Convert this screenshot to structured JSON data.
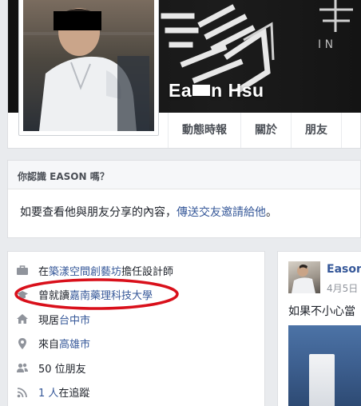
{
  "profile": {
    "name_prefix": "Ea",
    "name_suffix": "n Hsu"
  },
  "tabs": [
    "動態時報",
    "關於",
    "朋友"
  ],
  "know": {
    "title": "你認識 EASON 嗎？",
    "text": "如要查看他與朋友分享的內容，",
    "link": "傳送交友邀請給他",
    "end": "。"
  },
  "intro": {
    "work": {
      "pre": "在",
      "link": "築漾空間創藝坊",
      "post": "擔任設計師"
    },
    "study": {
      "pre": "曾就讀",
      "link": "嘉南藥理科技大學"
    },
    "lives": {
      "pre": "現居",
      "link": "台中市"
    },
    "from": {
      "pre": "來自",
      "link": "高雄市"
    },
    "friends": "50 位朋友",
    "followers": {
      "link": "1 人",
      "post": "在追蹤"
    }
  },
  "post": {
    "author": "Eason",
    "date": "4月5日",
    "text": "如果不小心當"
  },
  "colors": {
    "link": "#365899",
    "annotation": "#d9101b",
    "cover": "#141414"
  },
  "icons": [
    "briefcase-icon",
    "graduation-cap-icon",
    "home-icon",
    "location-pin-icon",
    "friends-icon",
    "rss-icon"
  ]
}
